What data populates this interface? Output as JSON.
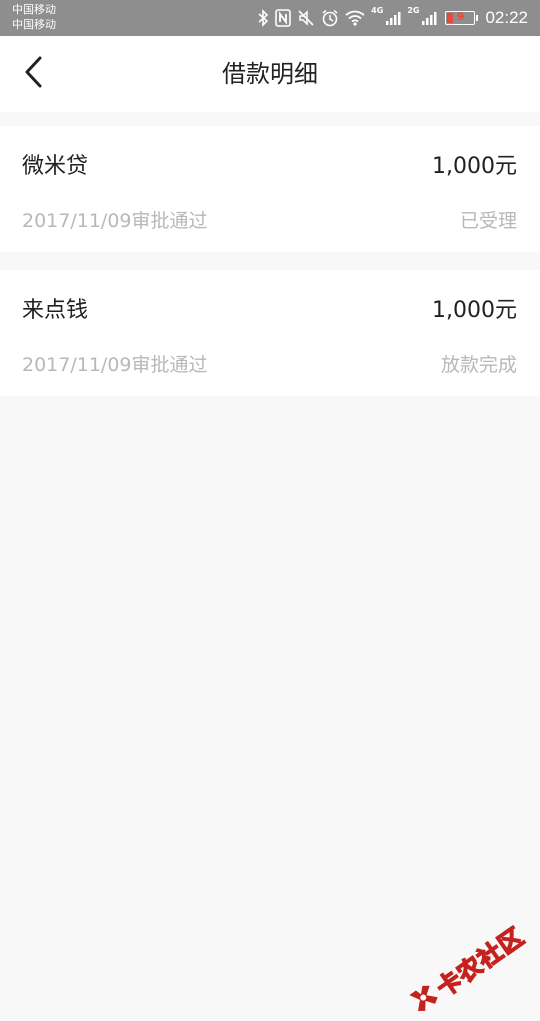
{
  "status_bar": {
    "carrier_1": "中国移动",
    "carrier_2": "中国移动",
    "net_1": "4G",
    "net_2": "2G",
    "battery_level": "9",
    "time": "02:22"
  },
  "header": {
    "title": "借款明细"
  },
  "loans": [
    {
      "name": "微米贷",
      "amount": "1,000元",
      "date_note": "2017/11/09审批通过",
      "status": "已受理"
    },
    {
      "name": "来点钱",
      "amount": "1,000元",
      "date_note": "2017/11/09审批通过",
      "status": "放款完成"
    }
  ],
  "watermark": {
    "text": "卡农社区"
  },
  "colors": {
    "page_bg": "#f8f8f8",
    "card_bg": "#ffffff",
    "primary_text": "#222222",
    "secondary_text": "#b8b8b8",
    "status_bar_bg": "#8e8e8e",
    "watermark_red": "#c4221f"
  }
}
